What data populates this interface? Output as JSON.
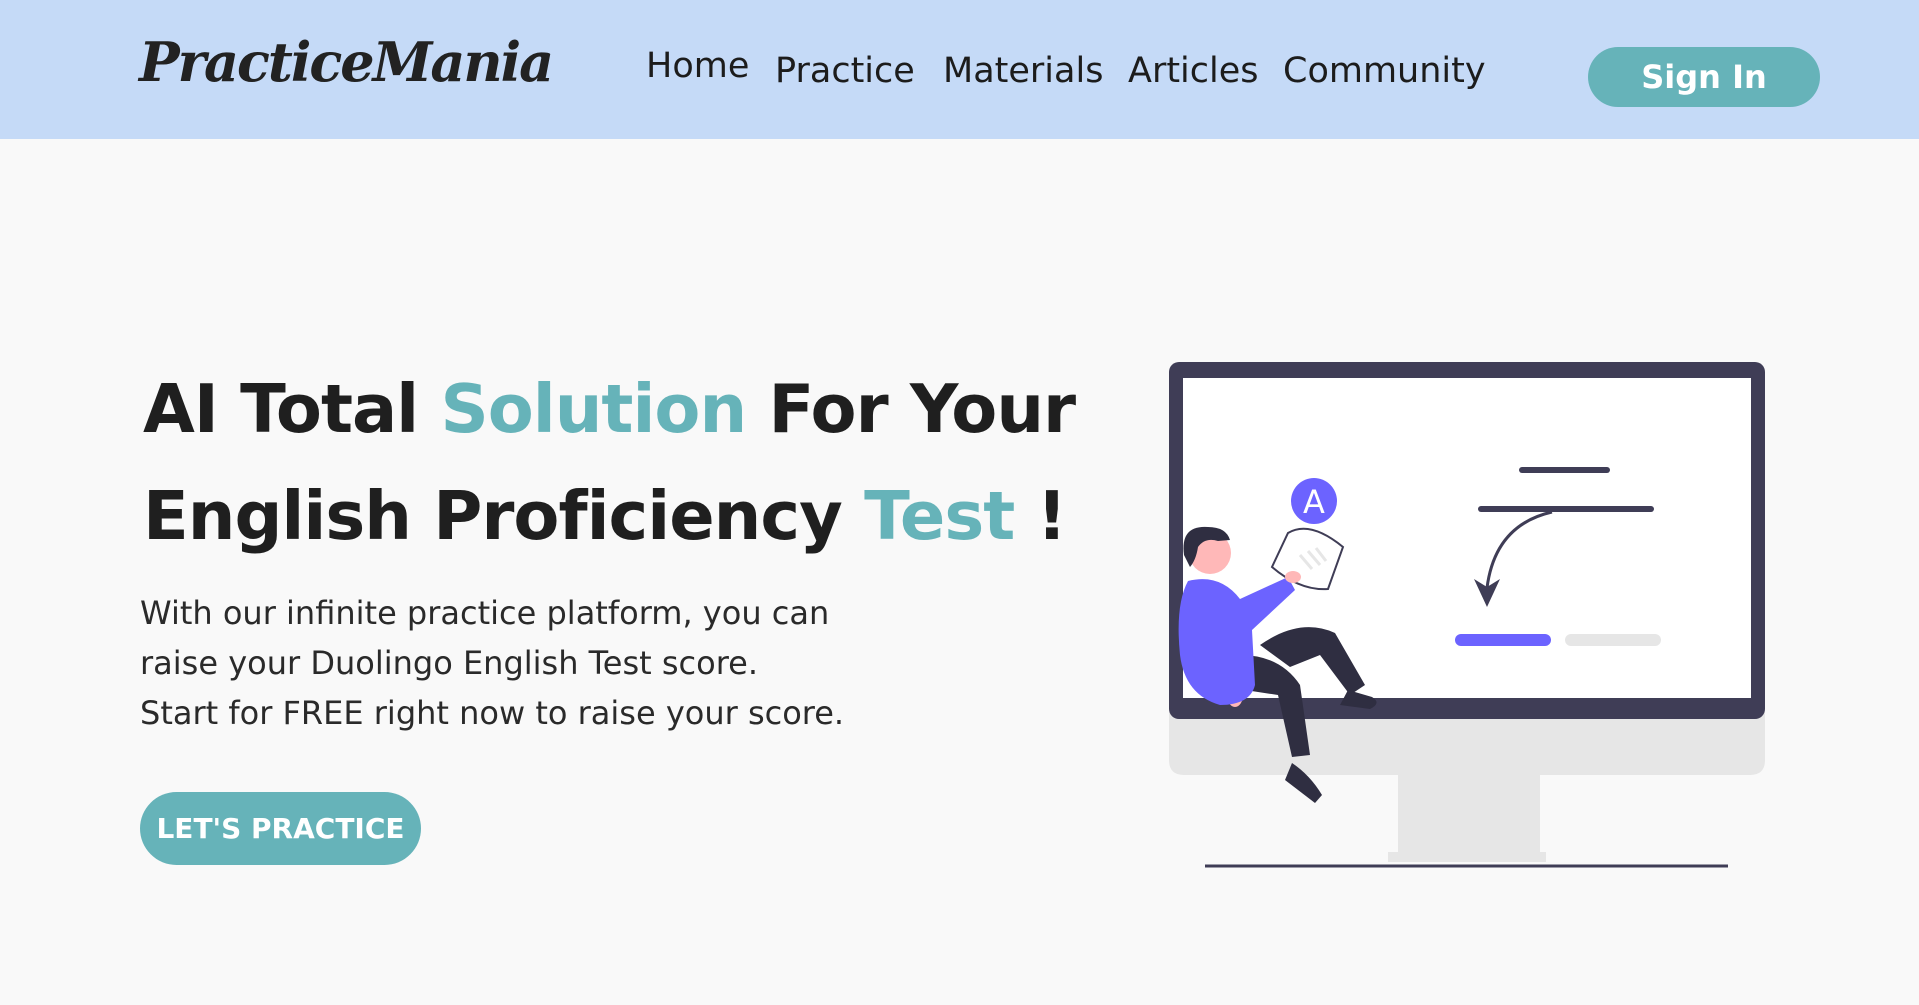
{
  "header": {
    "logo": "PracticeMania",
    "nav": [
      {
        "label": "Home"
      },
      {
        "label": "Practice"
      },
      {
        "label": "Materials"
      },
      {
        "label": "Articles"
      },
      {
        "label": "Community"
      }
    ],
    "signin_label": "Sign In"
  },
  "hero": {
    "title_line1_part1": "AI Total ",
    "title_line1_accent": "Solution",
    "title_line1_part2": " For Your",
    "title_line2_part1": "English Proficiency ",
    "title_line2_accent": "Test",
    "title_line2_part2": " !",
    "subtitle_lines": [
      "With our infinite practice platform, you can",
      "raise your Duolingo English Test score.",
      "Start for FREE right now to raise your score."
    ],
    "cta_label": "LET'S PRACTICE"
  },
  "illustration": {
    "badge_letter": "A"
  },
  "colors": {
    "header_bg": "#c5daf7",
    "accent": "#66b3b9",
    "page_bg": "#f9f9f9",
    "illustration_purple": "#6c63ff",
    "monitor_frame": "#3f3d56"
  },
  "icons": {
    "badge": "letter-a-badge-icon"
  }
}
